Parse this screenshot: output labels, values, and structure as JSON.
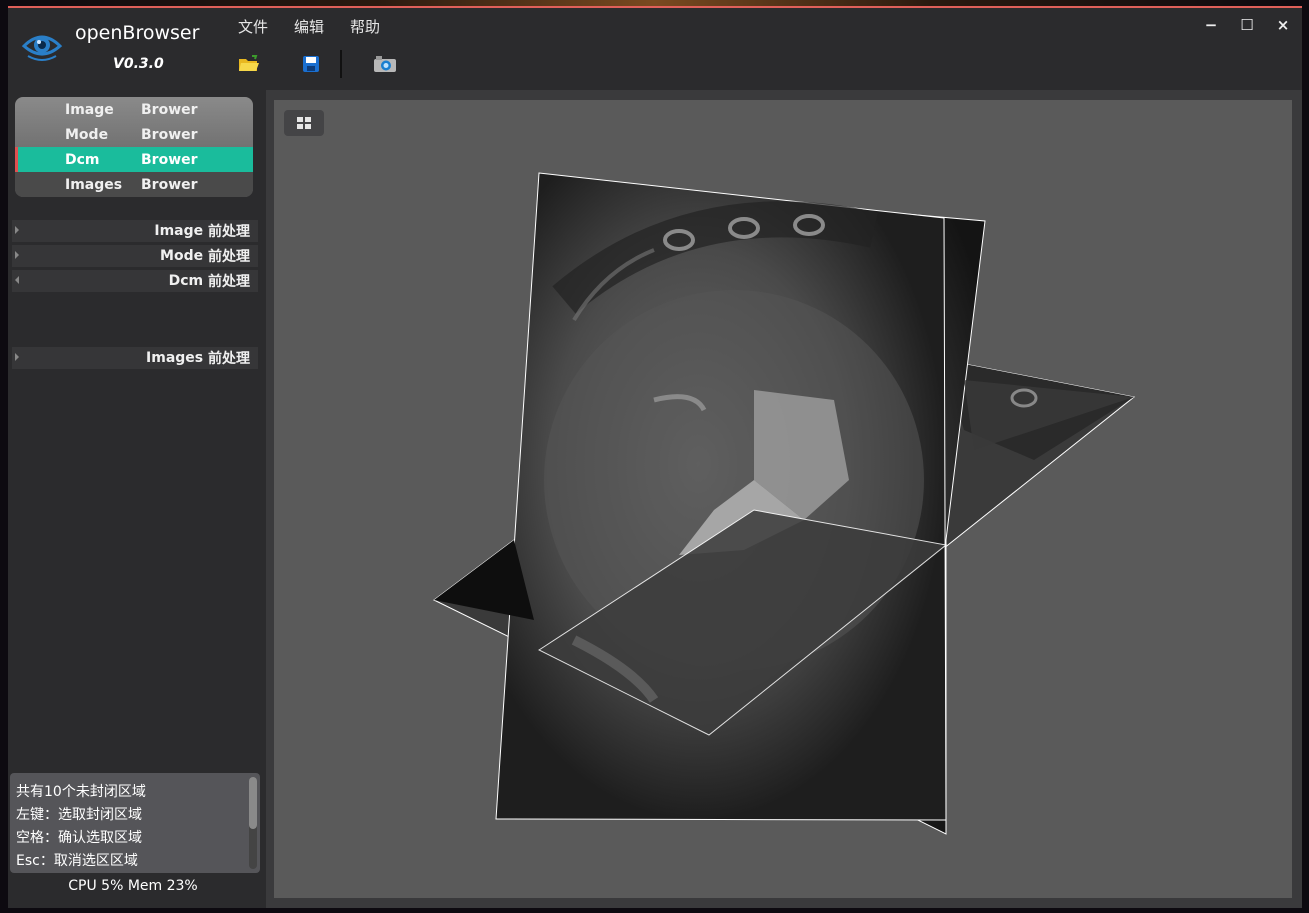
{
  "app": {
    "name": "openBrowser",
    "version": "V0.3.0"
  },
  "menu": {
    "file": "文件",
    "edit": "编辑",
    "help": "帮助"
  },
  "toolbar": {
    "open_icon": "folder-open-icon",
    "save_icon": "save-icon",
    "camera_icon": "camera-icon"
  },
  "window_controls": {
    "minimize": "−",
    "maximize": "☐",
    "close": "×"
  },
  "nav": {
    "items": [
      {
        "label": "Image",
        "suffix": "Brower"
      },
      {
        "label": "Mode",
        "suffix": "Brower"
      },
      {
        "label": "Dcm",
        "suffix": "Brower"
      },
      {
        "label": "Images",
        "suffix": "Brower"
      }
    ],
    "active_index": 2
  },
  "tree": [
    {
      "label": "Image",
      "suffix": "前处理"
    },
    {
      "label": "Mode",
      "suffix": "前处理"
    },
    {
      "label": "Dcm",
      "suffix": "前处理"
    },
    {
      "label": "Images",
      "suffix": "前处理"
    }
  ],
  "info": {
    "lines": [
      "共有10个未封闭区域",
      "左键：选取封闭区域",
      "空格：确认选取区域",
      "Esc：取消选区区域"
    ]
  },
  "status": {
    "text": "CPU 5%  Mem 23%"
  },
  "colors": {
    "accent": "#1abc9c",
    "title_border": "#e0605a",
    "viewport_bg": "#5a5a5a"
  }
}
